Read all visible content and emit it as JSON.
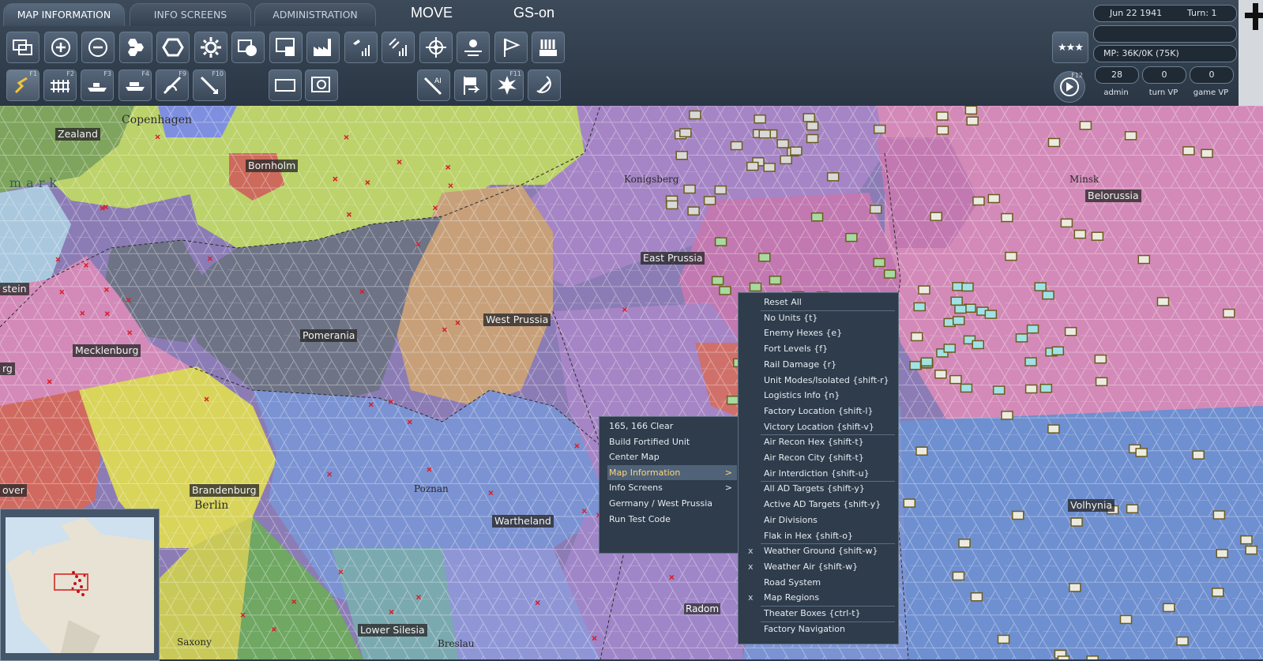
{
  "tabs": [
    "MAP INFORMATION",
    "INFO SCREENS",
    "ADMINISTRATION"
  ],
  "mode": {
    "move": "MOVE",
    "gs": "GS-on"
  },
  "toolbar_row1": [
    "windows-icon",
    "zoom-in-icon",
    "zoom-out-icon",
    "hex-cluster-icon",
    "hex-frame-icon",
    "gear-icon",
    "shape-toggle-icon",
    "chart-window-icon",
    "factory-icon",
    "air-recon-icon",
    "air-interdiction-icon",
    "target-crosshair-icon",
    "weather-icon",
    "flag-icon",
    "units-list-icon"
  ],
  "toolbar_row2": [
    {
      "icon": "move-path-icon",
      "key": "F1"
    },
    {
      "icon": "rail-icon",
      "key": "F2"
    },
    {
      "icon": "naval-icon",
      "key": "F3"
    },
    {
      "icon": "ship-transport-icon",
      "key": "F4"
    },
    {
      "icon": "paradrop-icon",
      "key": "F9"
    },
    {
      "icon": "air-attack-icon",
      "key": "F10"
    },
    {
      "icon": "select-rect-icon",
      "key": ""
    },
    {
      "icon": "magnify-square-icon",
      "key": ""
    },
    {
      "icon": "ai-air-icon",
      "key": ""
    },
    {
      "icon": "flag-arrow-icon",
      "key": ""
    },
    {
      "icon": "explosion-icon",
      "key": "F11"
    },
    {
      "icon": "hammer-sickle-icon",
      "key": ""
    }
  ],
  "end_turn": {
    "icon": "end-turn-icon",
    "key": "F12"
  },
  "stars": "★★★",
  "info": {
    "date": "Jun 22 1941",
    "turn": "Turn: 1",
    "empty": "",
    "mp": "MP:  36K/0K (75K)",
    "admin_value": "28",
    "turn_vp_value": "0",
    "game_vp_value": "0",
    "admin_label": "admin",
    "turn_vp_label": "turn VP",
    "game_vp_label": "game VP"
  },
  "regions": [
    "Zealand",
    "Bornholm",
    "Mecklenburg",
    "Pomerania",
    "West Prussia",
    "East Prussia",
    "Belorussia",
    "Brandenburg",
    "Wartheland",
    "Volhynia",
    "Lower Silesia",
    "stein",
    "over",
    "rg"
  ],
  "cities": [
    "Copenhagen",
    "Berlin",
    "Poznan",
    "Radom",
    "Saxony",
    "Breslau",
    "Konigsberg",
    "mark",
    "Minsk"
  ],
  "context_menu": [
    {
      "label": "165, 166     Clear",
      "arrow": ""
    },
    {
      "label": "Build Fortified Unit",
      "arrow": ""
    },
    {
      "label": "Center Map",
      "arrow": ""
    },
    {
      "label": "Map Information",
      "arrow": ">",
      "highlight": true
    },
    {
      "label": "Info Screens",
      "arrow": ">"
    },
    {
      "label": "Germany / West Prussia",
      "arrow": ""
    },
    {
      "label": "Run Test Code",
      "arrow": ""
    }
  ],
  "submenu": [
    {
      "label": "Reset All",
      "check": ""
    },
    {
      "label": "No Units  {t}",
      "check": ""
    },
    {
      "label": "Enemy Hexes  {e}",
      "check": ""
    },
    {
      "label": "Fort Levels  {f}",
      "check": ""
    },
    {
      "label": "Rail Damage  {r}",
      "check": ""
    },
    {
      "label": "Unit Modes/Isolated  {shift-r}",
      "check": ""
    },
    {
      "label": "Logistics Info  {n}",
      "check": ""
    },
    {
      "label": "Factory Location  {shift-l}",
      "check": ""
    },
    {
      "label": "Victory Location  {shift-v}",
      "check": ""
    },
    {
      "label": "Air Recon Hex  {shift-t}",
      "check": ""
    },
    {
      "label": "Air Recon City  {shift-t}",
      "check": ""
    },
    {
      "label": "Air Interdiction  {shift-u}",
      "check": ""
    },
    {
      "label": "All AD Targets  {shift-y}",
      "check": ""
    },
    {
      "label": "Active AD Targets  {shift-y}",
      "check": ""
    },
    {
      "label": "Air Divisions",
      "check": ""
    },
    {
      "label": "Flak in Hex  {shift-o}",
      "check": ""
    },
    {
      "label": "Weather Ground  {shift-w}",
      "check": "x"
    },
    {
      "label": "Weather Air  {shift-w}",
      "check": "x"
    },
    {
      "label": "Road System",
      "check": ""
    },
    {
      "label": "Map Regions",
      "check": "x"
    },
    {
      "label": "Theater Boxes  {ctrl-t}",
      "check": ""
    },
    {
      "label": "Factory Navigation",
      "check": ""
    }
  ],
  "colors": {
    "topbar": "#33404f",
    "menu_bg": "#2e3c4b",
    "highlight_text": "#ffd67a",
    "region_purple": "#a585c5",
    "region_pink": "#d38ab8",
    "region_blue": "#7b93d3",
    "region_yellow": "#d9d45a",
    "region_tan": "#c7a07a",
    "region_slate": "#6e7386",
    "region_lime": "#bcd26a",
    "region_green": "#6fa763",
    "region_red": "#cc6a5c"
  }
}
